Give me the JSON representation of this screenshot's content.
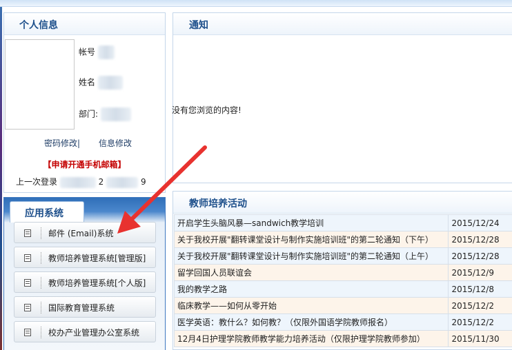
{
  "personal_info": {
    "title": "个人信息",
    "account_label": "帐号",
    "name_label": "姓名",
    "dept_label": "部门:",
    "password_link": "密码修改|",
    "info_link": "信息修改",
    "mobile_mail_link": "【申请开通手机邮箱】",
    "last_login_label": "上一次登录",
    "last_login_value_fragment_1": "2",
    "last_login_value_fragment_2": "9"
  },
  "notice": {
    "title": "通知",
    "empty_message": "没有您浏览的内容!"
  },
  "apps": {
    "tab_label": "应用系统",
    "items": [
      {
        "label": "邮件 (Email)系统",
        "icon": "document-icon"
      },
      {
        "label": "教师培养管理系统[管理版]",
        "icon": "document-icon"
      },
      {
        "label": "教师培养管理系统[个人版]",
        "icon": "document-icon"
      },
      {
        "label": "国际教育管理系统",
        "icon": "document-icon"
      },
      {
        "label": "校办产业管理办公室系统",
        "icon": "document-icon"
      }
    ]
  },
  "training": {
    "title": "教师培养活动",
    "rows": [
      {
        "title": "开启学生头脑风暴—sandwich教学培训",
        "date": "2015/12/24"
      },
      {
        "title": "关于我校开展\"翻转课堂设计与制作实施培训班\"的第二轮通知（下午）",
        "date": "2015/12/28"
      },
      {
        "title": "关于我校开展\"翻转课堂设计与制作实施培训班\"的第二轮通知（上午）",
        "date": "2015/12/28"
      },
      {
        "title": "留学回国人员联谊会",
        "date": "2015/12/9"
      },
      {
        "title": "我的教学之路",
        "date": "2015/12/8"
      },
      {
        "title": "临床教学——如何从零开始",
        "date": "2015/12/2"
      },
      {
        "title": "医学英语：教什么？如何教？（仅限外国语学院教师报名）",
        "date": "2015/12/2"
      },
      {
        "title": "12月4日护理学院教师教学能力培养活动（仅限护理学院教师参加）",
        "date": "2015/11/30"
      }
    ]
  },
  "colors": {
    "title_blue": "#1d4f8b",
    "arrow_red": "#e8322f",
    "alert_red": "#c40000"
  }
}
